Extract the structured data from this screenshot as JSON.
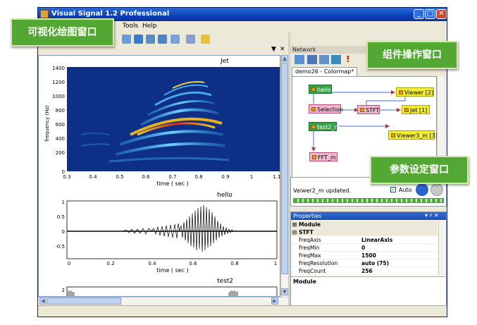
{
  "window": {
    "title": "Visual Signal 1.2 Professional"
  },
  "menu": [
    "Tools",
    "Help"
  ],
  "doc_controls": {
    "dropdown": "▼",
    "close": "✕"
  },
  "plots": {
    "jet": {
      "title": "Jet",
      "ylabel": "frequency (Hz)",
      "xlabel": "time ( sec )",
      "yticks": [
        "1400",
        "1200",
        "1000",
        "800",
        "600",
        "400",
        "200",
        "0"
      ],
      "xticks": [
        "0.3",
        "0.4",
        "0.5",
        "0.6",
        "0.7",
        "0.8",
        "0.9",
        "1",
        "1.1"
      ]
    },
    "hello": {
      "title": "hello",
      "xlabel": "time ( sec )",
      "yticks": [
        "1",
        "0.5",
        "0",
        "-0.5"
      ],
      "xticks": [
        "0",
        "0.2",
        "0.4",
        "0.6",
        "0.8",
        "1"
      ]
    },
    "test2": {
      "title": "test2",
      "yticks": [
        "2"
      ]
    }
  },
  "network": {
    "header": "Network",
    "tab": "demo26 - Colormap*",
    "nodes": [
      {
        "label": "hello",
        "color": "#3aa14c"
      },
      {
        "label": "Viewer [2]",
        "color": "#f3ee33"
      },
      {
        "label": "Selection",
        "color": "#f4b7d0"
      },
      {
        "label": "STFT",
        "color": "#f4b7d0"
      },
      {
        "label": "Jet [1]",
        "color": "#f3ee33"
      },
      {
        "label": "test2_m",
        "color": "#3aa14c"
      },
      {
        "label": "Viewer3_m [3]",
        "color": "#f3ee33"
      },
      {
        "label": "FFT_m",
        "color": "#f4b7d0"
      }
    ]
  },
  "log": {
    "message": "Veiwer2_m updated.",
    "auto_label": "Auto",
    "auto_checked": true
  },
  "properties": {
    "header": "Properties",
    "header_controls": "▾ ♯ ✕",
    "group_module": "Module",
    "group_stft": "STFT",
    "rows": [
      {
        "key": "FreqAxis",
        "value": "LinearAxis"
      },
      {
        "key": "FreqMin",
        "value": "0"
      },
      {
        "key": "FreqMax",
        "value": "1500"
      },
      {
        "key": "FreqResolution",
        "value": "auto (75)"
      },
      {
        "key": "FreqCount",
        "value": "256"
      }
    ],
    "description": "Module"
  },
  "annotations": {
    "plot_window": "可视化绘图窗口",
    "component_window": "组件操作窗口",
    "param_window": "参数设定窗口"
  }
}
